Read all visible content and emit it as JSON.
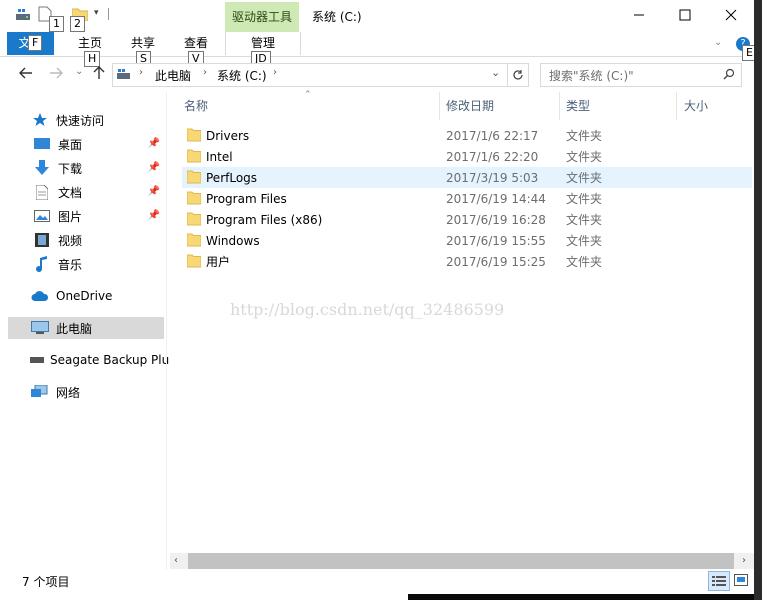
{
  "titlebar": {
    "context_tab": "驱动器工具",
    "title": "系统 (C:)",
    "keytips": [
      "1",
      "2"
    ]
  },
  "ribbon": {
    "file": "文件",
    "file_keytip": "F",
    "tabs": [
      {
        "label": "主页",
        "keytip": "H"
      },
      {
        "label": "共享",
        "keytip": "S"
      },
      {
        "label": "查看",
        "keytip": "V"
      },
      {
        "label": "管理",
        "keytip": "JD"
      }
    ],
    "help_keytip": "E"
  },
  "address": {
    "crumbs": [
      "此电脑",
      "系统 (C:)"
    ],
    "search_placeholder": "搜索\"系统 (C:)\""
  },
  "nav": {
    "quick_access": "快速访问",
    "pinned": [
      "桌面",
      "下载",
      "文档",
      "图片"
    ],
    "others": [
      "视频",
      "音乐"
    ],
    "onedrive": "OneDrive",
    "this_pc": "此电脑",
    "drive": "Seagate Backup Plu",
    "network": "网络"
  },
  "columns": {
    "name": "名称",
    "date": "修改日期",
    "type": "类型",
    "size": "大小"
  },
  "files": [
    {
      "name": "Drivers",
      "date": "2017/1/6 22:17",
      "type": "文件夹"
    },
    {
      "name": "Intel",
      "date": "2017/1/6 22:20",
      "type": "文件夹"
    },
    {
      "name": "PerfLogs",
      "date": "2017/3/19 5:03",
      "type": "文件夹"
    },
    {
      "name": "Program Files",
      "date": "2017/6/19 14:44",
      "type": "文件夹"
    },
    {
      "name": "Program Files (x86)",
      "date": "2017/6/19 16:28",
      "type": "文件夹"
    },
    {
      "name": "Windows",
      "date": "2017/6/19 15:55",
      "type": "文件夹"
    },
    {
      "name": "用户",
      "date": "2017/6/19 15:25",
      "type": "文件夹"
    }
  ],
  "watermark": "http://blog.csdn.net/qq_32486599",
  "status": {
    "count": "7 个项目"
  },
  "colors": {
    "accent": "#1979ca",
    "context": "#cfe9b4",
    "hover": "#e5f3ff",
    "selected": "#d9d9d9",
    "folder": "#f8d775"
  }
}
